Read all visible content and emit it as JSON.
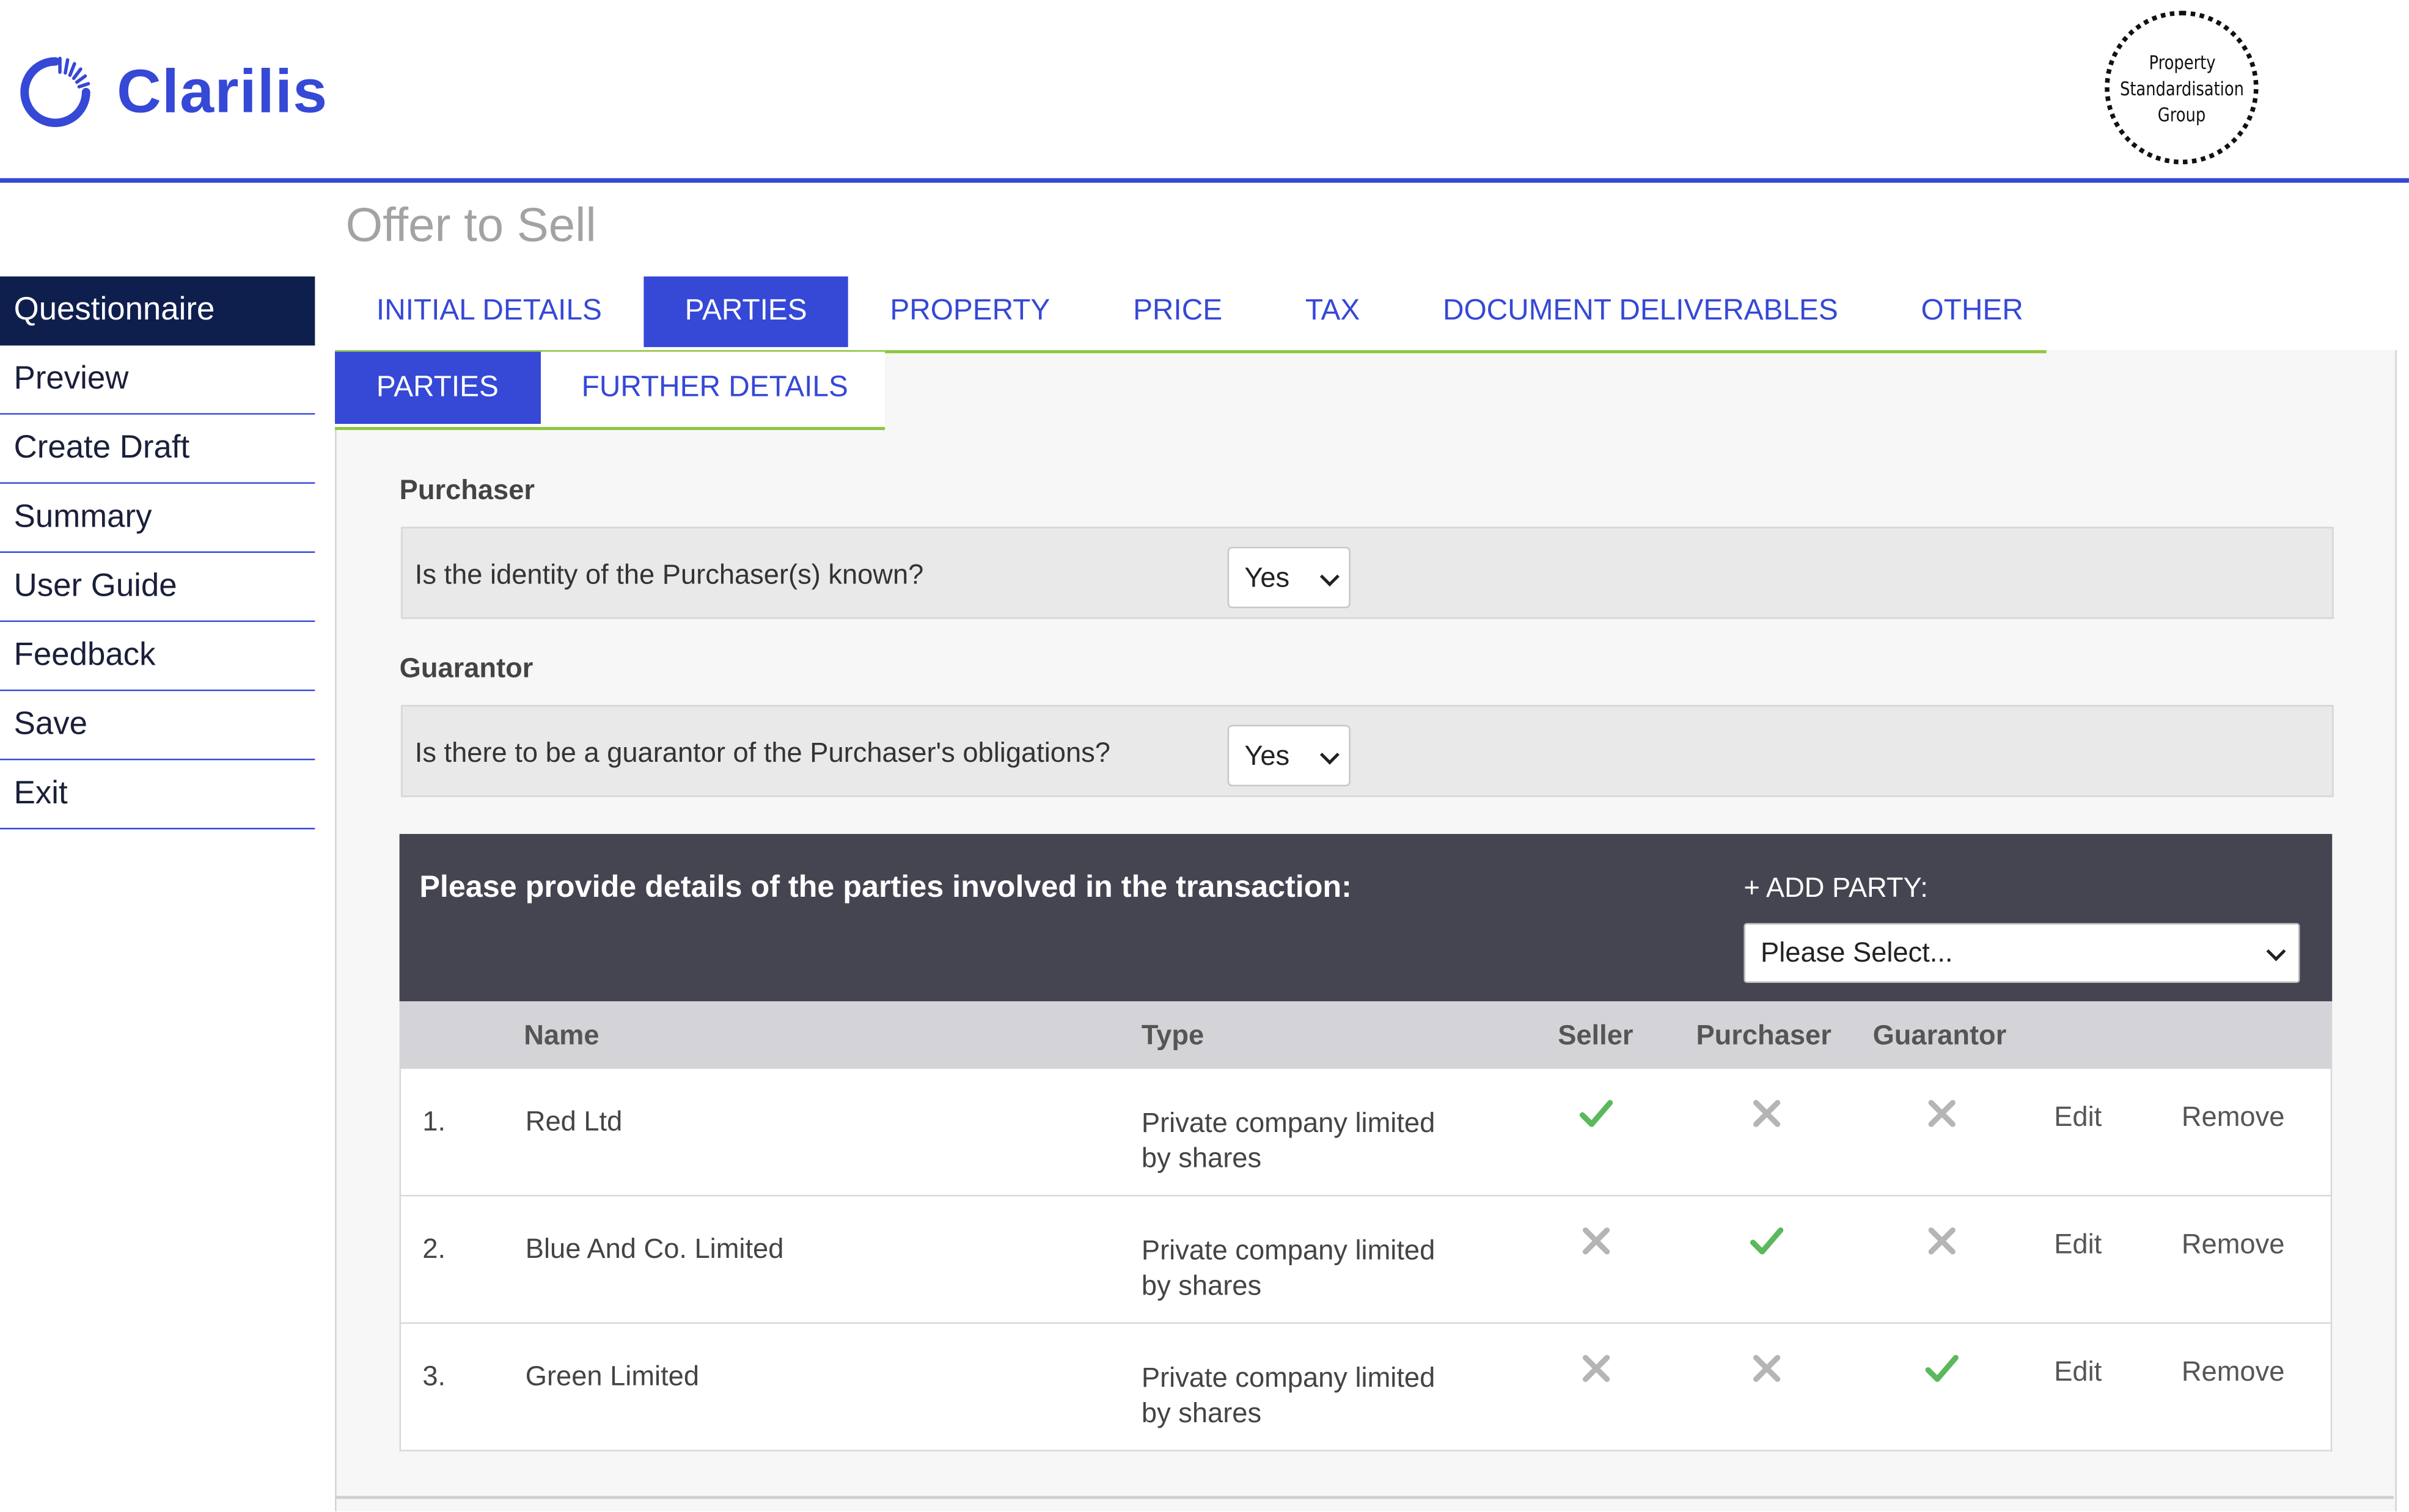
{
  "header": {
    "brand": "Clarilis",
    "seal_lines": [
      "Property",
      "Standardisation",
      "Group"
    ]
  },
  "page_title": "Offer to Sell",
  "sidebar": {
    "items": [
      {
        "label": "Questionnaire",
        "active": true
      },
      {
        "label": "Preview"
      },
      {
        "label": "Create Draft"
      },
      {
        "label": "Summary"
      },
      {
        "label": "User Guide"
      },
      {
        "label": "Feedback"
      },
      {
        "label": "Save"
      },
      {
        "label": "Exit"
      }
    ]
  },
  "tabs": [
    {
      "label": "INITIAL DETAILS"
    },
    {
      "label": "PARTIES",
      "active": true
    },
    {
      "label": "PROPERTY"
    },
    {
      "label": "PRICE"
    },
    {
      "label": "TAX"
    },
    {
      "label": "DOCUMENT DELIVERABLES"
    },
    {
      "label": "OTHER"
    }
  ],
  "subtabs": [
    {
      "label": "PARTIES",
      "active": true
    },
    {
      "label": "FURTHER DETAILS"
    }
  ],
  "purchaser": {
    "heading": "Purchaser",
    "question": "Is the identity of the Purchaser(s) known?",
    "answer": "Yes"
  },
  "guarantor": {
    "heading": "Guarantor",
    "question": "Is there to be a guarantor of the Purchaser's obligations?",
    "answer": "Yes"
  },
  "parties": {
    "title": "Please provide details of the parties involved in the transaction:",
    "add_label": "+ ADD PARTY:",
    "add_select_value": "Please Select...",
    "columns": {
      "name": "Name",
      "type": "Type",
      "seller": "Seller",
      "purchaser": "Purchaser",
      "guarantor": "Guarantor"
    },
    "rows": [
      {
        "num": "1.",
        "name": "Red Ltd",
        "type_line1": "Private company limited",
        "type_line2": "by shares",
        "seller": true,
        "purchaser": false,
        "guarantor": false,
        "edit": "Edit",
        "remove": "Remove"
      },
      {
        "num": "2.",
        "name": "Blue And Co. Limited",
        "type_line1": "Private company limited",
        "type_line2": "by shares",
        "seller": false,
        "purchaser": true,
        "guarantor": false,
        "edit": "Edit",
        "remove": "Remove"
      },
      {
        "num": "3.",
        "name": "Green Limited",
        "type_line1": "Private company limited",
        "type_line2": "by shares",
        "seller": false,
        "purchaser": false,
        "guarantor": true,
        "edit": "Edit",
        "remove": "Remove"
      }
    ]
  },
  "colors": {
    "brand_blue": "#3548d6",
    "nav_dark": "#0f1f4d",
    "accent_green": "#8dc63f",
    "check_green": "#5cb85c",
    "cross_grey": "#b5b5b5",
    "panel_dark": "#454552"
  }
}
